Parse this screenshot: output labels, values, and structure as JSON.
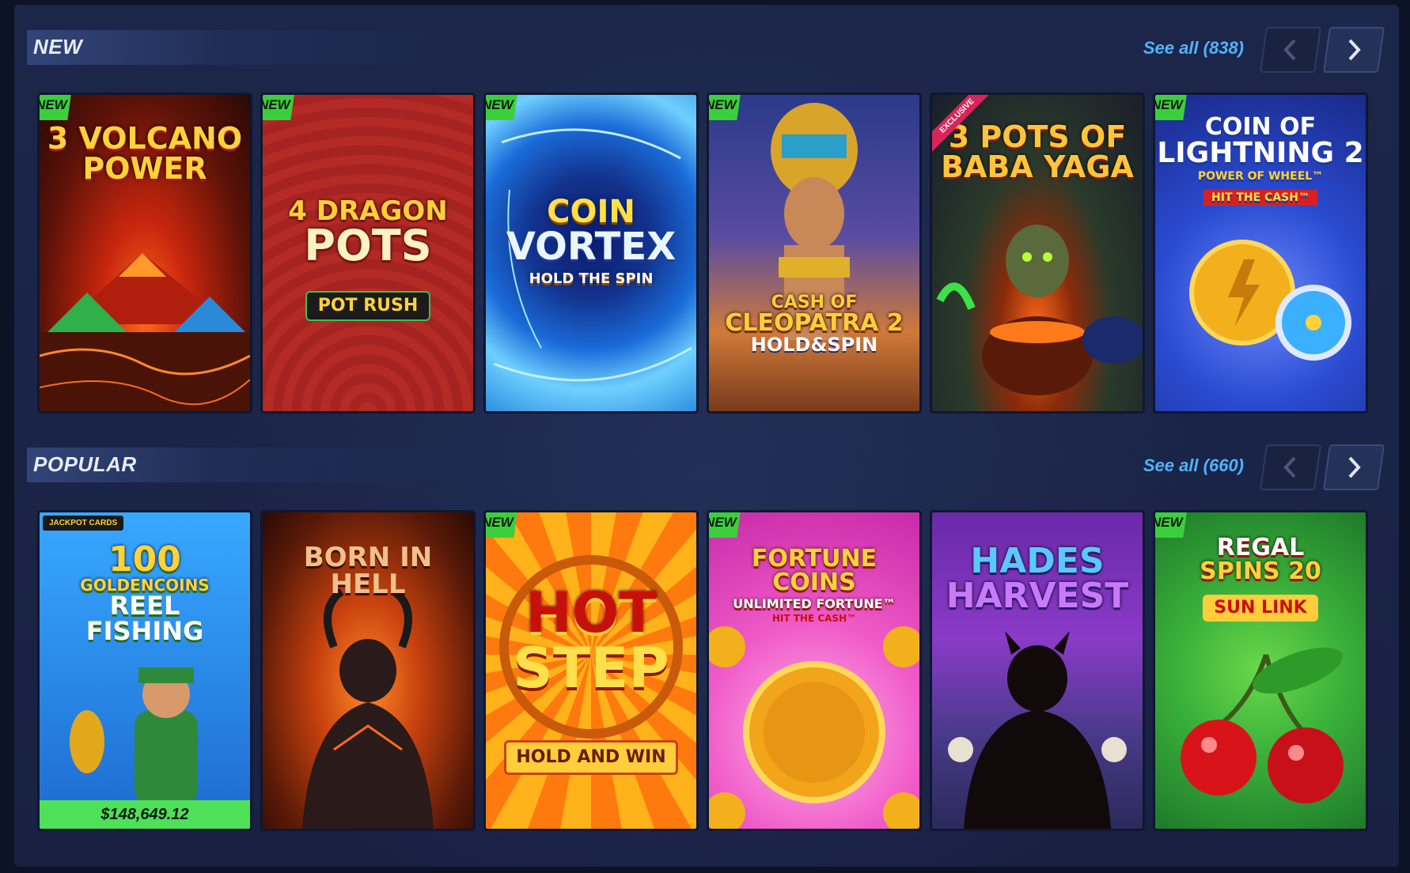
{
  "sections": [
    {
      "title": "NEW",
      "see_all": "See all (838)",
      "cards": [
        {
          "art_lines": [
            "3 VOLCANO",
            "POWER"
          ],
          "badge": "NEW"
        },
        {
          "art_lines": [
            "4 DRAGON",
            "POTS",
            "POT RUSH"
          ],
          "badge": "NEW"
        },
        {
          "art_lines": [
            "COIN",
            "VORTEX",
            "HOLD THE SPIN"
          ],
          "badge": "NEW"
        },
        {
          "art_lines": [
            "CASH OF",
            "CLEOPATRA 2",
            "HOLD&SPIN"
          ],
          "badge": "NEW"
        },
        {
          "art_lines": [
            "3 POTS OF",
            "BABA YAGA"
          ],
          "ribbon": "EXCLUSIVE"
        },
        {
          "art_lines": [
            "COIN OF",
            "LIGHTNING 2",
            "POWER OF WHEEL™",
            "HIT THE CASH™"
          ],
          "badge": "NEW"
        }
      ]
    },
    {
      "title": "POPULAR",
      "see_all": "See all (660)",
      "cards": [
        {
          "art_lines": [
            "100",
            "GOLDENCOINS",
            "REEL",
            "FISHING"
          ],
          "tag": "JACKPOT CARDS",
          "jackpot": "$148,649.12"
        },
        {
          "art_lines": [
            "BORN IN HELL"
          ]
        },
        {
          "art_lines": [
            "HOT",
            "STEP",
            "HOLD AND WIN"
          ],
          "badge": "NEW"
        },
        {
          "art_lines": [
            "FORTUNE COINS",
            "UNLIMITED FORTUNE™",
            "HIT THE CASH™"
          ],
          "badge": "NEW"
        },
        {
          "art_lines": [
            "HADES",
            "HARVEST"
          ]
        },
        {
          "art_lines": [
            "REGAL",
            "SPINS 20",
            "SUN LINK"
          ],
          "badge": "NEW"
        }
      ]
    }
  ],
  "icons": {
    "prev": "chevron-left-icon",
    "next": "chevron-right-icon"
  },
  "colors": {
    "accent": "#4fb3ff",
    "badge": "#3ccf3c",
    "jackpot": "#4fe05a",
    "background": "#1a2446"
  }
}
